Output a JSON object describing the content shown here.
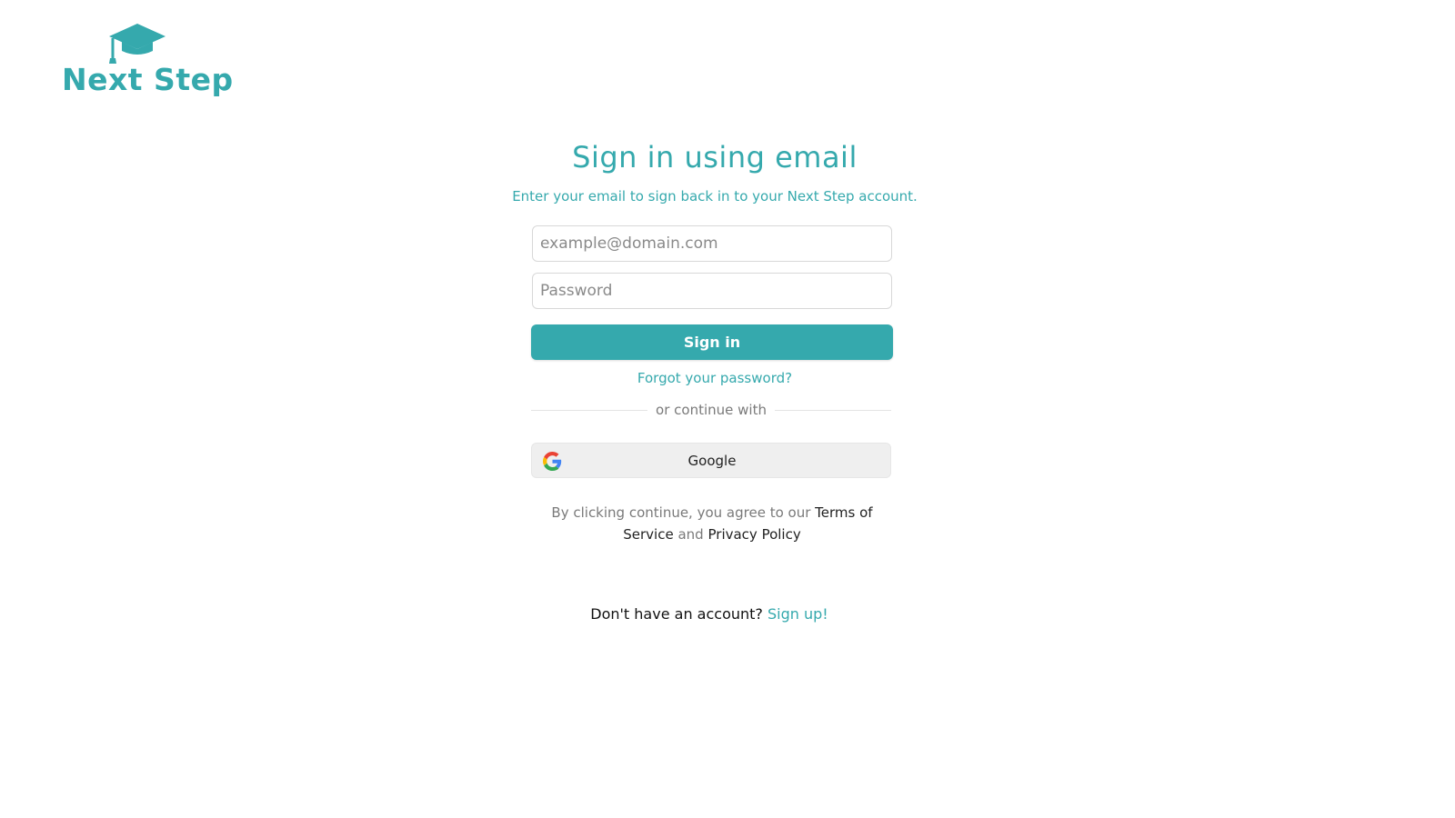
{
  "brand": {
    "name": "Next Step",
    "color": "#35a9ad"
  },
  "heading": {
    "title": "Sign in using email",
    "subtitle": "Enter your email to sign back in to your Next Step account."
  },
  "form": {
    "email_placeholder": "example@domain.com",
    "email_value": "",
    "password_placeholder": "Password",
    "password_value": "",
    "signin_label": "Sign in",
    "forgot_label": "Forgot your password?"
  },
  "divider": {
    "label": "or continue with"
  },
  "oauth": {
    "google_label": "Google",
    "google_icon": "google-icon"
  },
  "legal": {
    "prefix": "By clicking continue, you agree to our",
    "terms_label": "Terms of Service",
    "conjunction": "and",
    "privacy_label": "Privacy Policy"
  },
  "footer": {
    "prompt": "Don't have an account?",
    "signup_label": "Sign up!"
  }
}
